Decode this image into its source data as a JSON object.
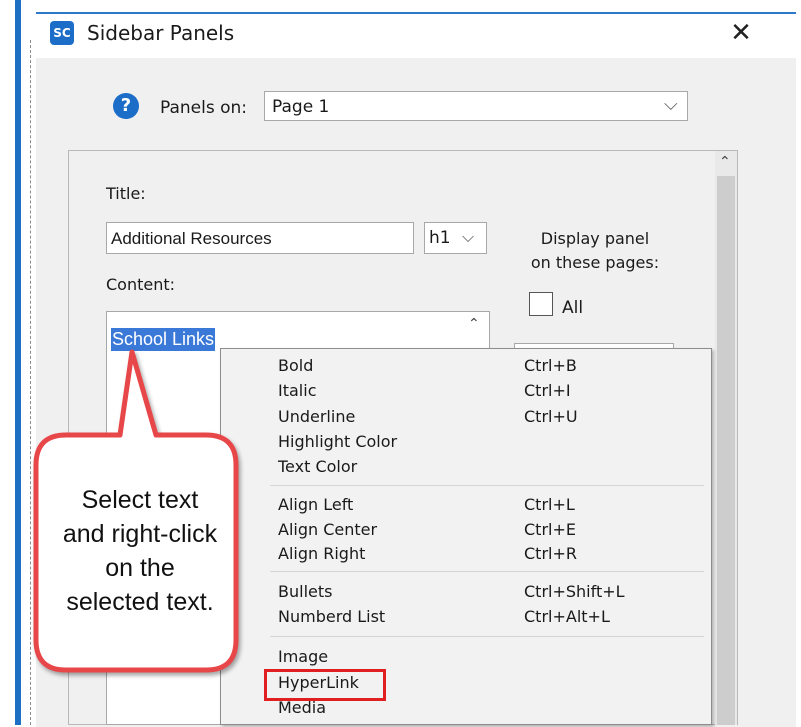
{
  "dialog": {
    "title": "Sidebar Panels",
    "icon_label": "SC",
    "close_glyph": "✕"
  },
  "panels_on": {
    "help_glyph": "?",
    "label": "Panels on:",
    "value": "Page 1",
    "arrow": "⌵"
  },
  "form": {
    "title_label": "Title:",
    "title_value": "Additional Resources",
    "heading_value": "h1",
    "heading_arrow": "⌵",
    "content_label": "Content:",
    "content_selected": "School Links",
    "display_label_1": "Display panel",
    "display_label_2": "on these pages:",
    "all_label": "All",
    "scroll_up": "⌃"
  },
  "context_menu": {
    "groups": [
      [
        {
          "label": "Bold",
          "shortcut": "Ctrl+B"
        },
        {
          "label": "Italic",
          "shortcut": "Ctrl+I"
        },
        {
          "label": "Underline",
          "shortcut": "Ctrl+U"
        },
        {
          "label": "Highlight Color",
          "shortcut": ""
        },
        {
          "label": "Text Color",
          "shortcut": ""
        }
      ],
      [
        {
          "label": "Align Left",
          "shortcut": "Ctrl+L"
        },
        {
          "label": "Align Center",
          "shortcut": "Ctrl+E"
        },
        {
          "label": "Align Right",
          "shortcut": "Ctrl+R"
        }
      ],
      [
        {
          "label": "Bullets",
          "shortcut": "Ctrl+Shift+L"
        },
        {
          "label": "Numberd List",
          "shortcut": "Ctrl+Alt+L"
        }
      ],
      [
        {
          "label": "Image",
          "shortcut": ""
        },
        {
          "label": "HyperLink",
          "shortcut": ""
        },
        {
          "label": "Media",
          "shortcut": ""
        }
      ]
    ]
  },
  "callout": {
    "line1": "Select text",
    "line2": "and right-click",
    "line3": "on the",
    "line4": "selected text."
  },
  "colors": {
    "accent": "#1c6dc8",
    "selection": "#3b79d8",
    "highlight_box": "#e02020",
    "callout_border": "#e8474a"
  }
}
